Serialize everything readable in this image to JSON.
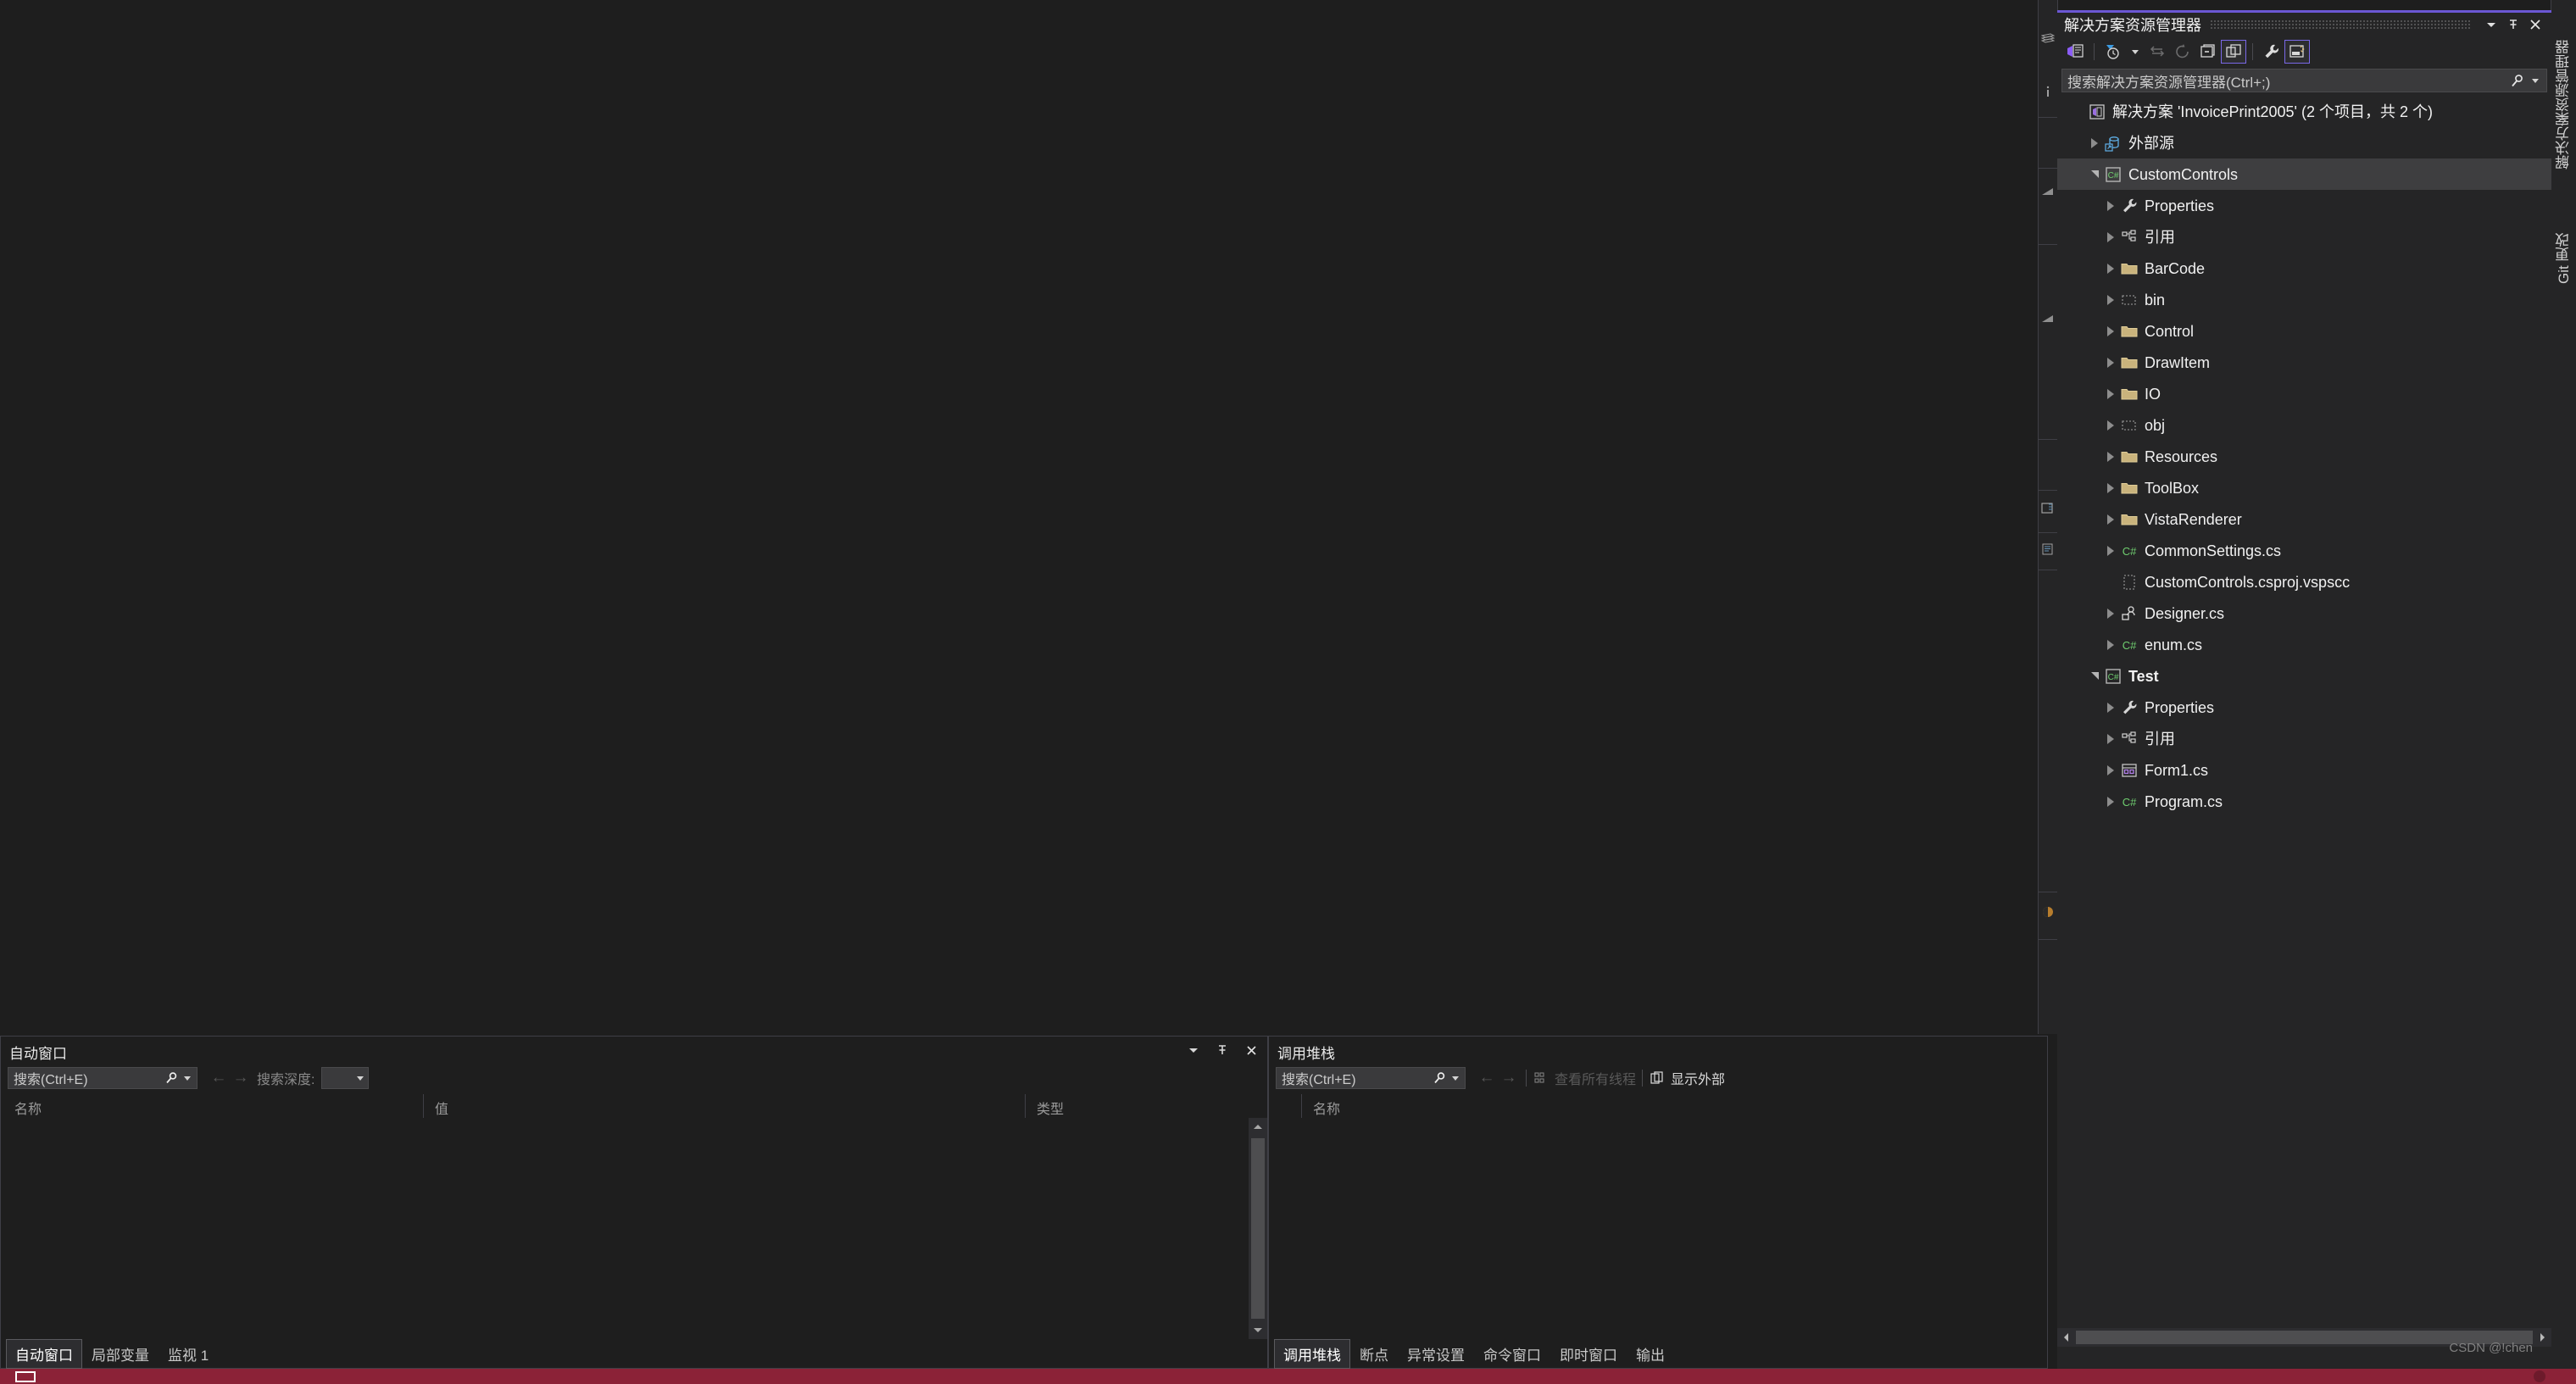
{
  "solution_explorer": {
    "title": "解决方案资源管理器",
    "search_placeholder": "搜索解决方案资源管理器(Ctrl+;)",
    "titlebar_buttons": [
      {
        "name": "window-menu-dropdown",
        "glyph": "▾"
      },
      {
        "name": "auto-hide-pin",
        "glyph": "pin"
      },
      {
        "name": "close-window",
        "glyph": "✕"
      }
    ],
    "toolbar": [
      {
        "name": "home-solution-icon",
        "label": "主页",
        "selected": false,
        "dim": false
      },
      {
        "name": "pending-changes-filter-icon",
        "label": "挂起的更改筛选器",
        "selected": false,
        "dim": false
      },
      {
        "name": "filter-dropdown-caret",
        "label": "筛选器下拉",
        "selected": false,
        "dim": false
      },
      {
        "name": "sync-with-active-document-icon",
        "label": "与活动文档同步",
        "selected": false,
        "dim": true
      },
      {
        "name": "refresh-icon",
        "label": "刷新",
        "selected": false,
        "dim": true
      },
      {
        "name": "collapse-all-icon",
        "label": "全部折叠",
        "selected": false,
        "dim": false
      },
      {
        "name": "show-all-files-icon",
        "label": "显示所有文件",
        "selected": true,
        "dim": false
      },
      {
        "name": "properties-wrench-icon",
        "label": "属性",
        "selected": false,
        "dim": false
      },
      {
        "name": "preview-selected-items-icon",
        "label": "预览选定项",
        "selected": true,
        "dim": false
      }
    ],
    "tree": [
      {
        "label": "解决方案 'InvoicePrint2005' (2 个项目，共 2 个)",
        "indent": 0,
        "expander": "none",
        "icon": "solution-icon",
        "bold": false,
        "selected": false
      },
      {
        "label": "外部源",
        "indent": 1,
        "expander": "collapsed",
        "icon": "external-sources-icon",
        "bold": false,
        "selected": false
      },
      {
        "label": "CustomControls",
        "indent": 1,
        "expander": "expanded",
        "icon": "csharp-project-icon",
        "bold": false,
        "selected": true
      },
      {
        "label": "Properties",
        "indent": 2,
        "expander": "collapsed",
        "icon": "wrench-icon",
        "bold": false,
        "selected": false
      },
      {
        "label": "引用",
        "indent": 2,
        "expander": "collapsed",
        "icon": "references-icon",
        "bold": false,
        "selected": false
      },
      {
        "label": "BarCode",
        "indent": 2,
        "expander": "collapsed",
        "icon": "folder-icon",
        "bold": false,
        "selected": false
      },
      {
        "label": "bin",
        "indent": 2,
        "expander": "collapsed",
        "icon": "folder-hidden-icon",
        "bold": false,
        "selected": false
      },
      {
        "label": "Control",
        "indent": 2,
        "expander": "collapsed",
        "icon": "folder-icon",
        "bold": false,
        "selected": false
      },
      {
        "label": "DrawItem",
        "indent": 2,
        "expander": "collapsed",
        "icon": "folder-icon",
        "bold": false,
        "selected": false
      },
      {
        "label": "IO",
        "indent": 2,
        "expander": "collapsed",
        "icon": "folder-icon",
        "bold": false,
        "selected": false
      },
      {
        "label": "obj",
        "indent": 2,
        "expander": "collapsed",
        "icon": "folder-hidden-icon",
        "bold": false,
        "selected": false
      },
      {
        "label": "Resources",
        "indent": 2,
        "expander": "collapsed",
        "icon": "folder-icon",
        "bold": false,
        "selected": false
      },
      {
        "label": "ToolBox",
        "indent": 2,
        "expander": "collapsed",
        "icon": "folder-icon",
        "bold": false,
        "selected": false
      },
      {
        "label": "VistaRenderer",
        "indent": 2,
        "expander": "collapsed",
        "icon": "folder-icon",
        "bold": false,
        "selected": false
      },
      {
        "label": "CommonSettings.cs",
        "indent": 2,
        "expander": "collapsed",
        "icon": "csharp-file-icon",
        "bold": false,
        "selected": false
      },
      {
        "label": "CustomControls.csproj.vspscc",
        "indent": 2,
        "expander": "none",
        "icon": "file-hidden-icon",
        "bold": false,
        "selected": false
      },
      {
        "label": "Designer.cs",
        "indent": 2,
        "expander": "collapsed",
        "icon": "designer-file-icon",
        "bold": false,
        "selected": false
      },
      {
        "label": "enum.cs",
        "indent": 2,
        "expander": "collapsed",
        "icon": "csharp-file-icon",
        "bold": false,
        "selected": false
      },
      {
        "label": "Test",
        "indent": 1,
        "expander": "expanded",
        "icon": "csharp-project-icon",
        "bold": true,
        "selected": false
      },
      {
        "label": "Properties",
        "indent": 2,
        "expander": "collapsed",
        "icon": "wrench-icon",
        "bold": false,
        "selected": false
      },
      {
        "label": "引用",
        "indent": 2,
        "expander": "collapsed",
        "icon": "references-icon",
        "bold": false,
        "selected": false
      },
      {
        "label": "Form1.cs",
        "indent": 2,
        "expander": "collapsed",
        "icon": "form-file-icon",
        "bold": false,
        "selected": false
      },
      {
        "label": "Program.cs",
        "indent": 2,
        "expander": "collapsed",
        "icon": "csharp-file-icon",
        "bold": false,
        "selected": false
      }
    ]
  },
  "vertical_tabs": [
    {
      "label": "解决方案资源管理器",
      "name": "vtab-solution-explorer"
    },
    {
      "label": "Git 更改",
      "name": "vtab-git-changes"
    }
  ],
  "autos_panel": {
    "title": "自动窗口",
    "search_placeholder": "搜索(Ctrl+E)",
    "search_depth_label": "搜索深度:",
    "search_depth_value": "",
    "columns": [
      "名称",
      "值",
      "类型"
    ],
    "rows": [],
    "tabs": [
      {
        "label": "自动窗口",
        "active": true
      },
      {
        "label": "局部变量",
        "active": false
      },
      {
        "label": "监视 1",
        "active": false
      }
    ]
  },
  "callstack_panel": {
    "title": "调用堆栈",
    "search_placeholder": "搜索(Ctrl+E)",
    "view_all_threads_label": "查看所有线程",
    "show_external_label": "显示外部",
    "columns": [
      "名称"
    ],
    "rows": [],
    "tabs": [
      {
        "label": "调用堆栈",
        "active": true
      },
      {
        "label": "断点",
        "active": false
      },
      {
        "label": "异常设置",
        "active": false
      },
      {
        "label": "命令窗口",
        "active": false
      },
      {
        "label": "即时窗口",
        "active": false
      },
      {
        "label": "输出",
        "active": false
      }
    ]
  },
  "watermark": "CSDN @!chen",
  "colors": {
    "accent": "#6b57d4",
    "selection": "#3e3e40",
    "status_bar": "#8b2237",
    "folder": "#c9b37c",
    "csharp_green": "#6fce6f",
    "panel_bg": "#1e1e1e",
    "chrome_bg": "#252526"
  }
}
